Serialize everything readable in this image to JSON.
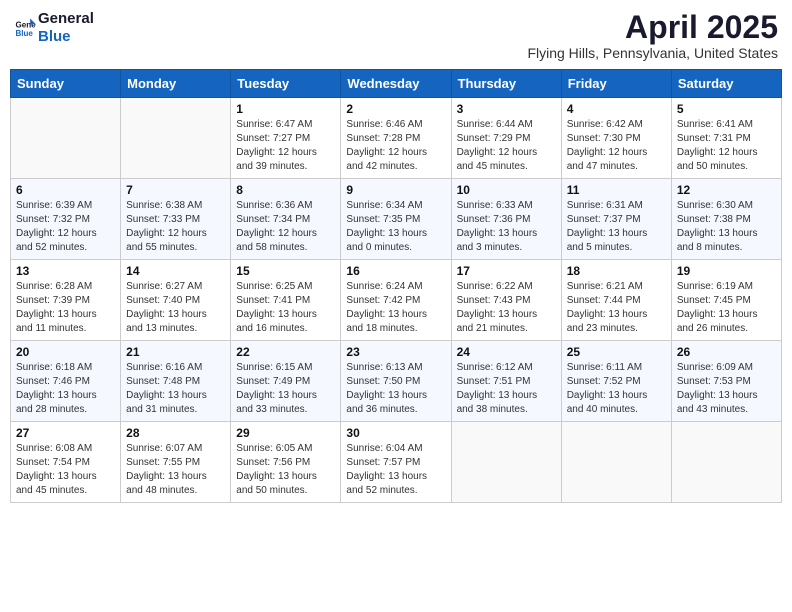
{
  "header": {
    "logo_line1": "General",
    "logo_line2": "Blue",
    "month": "April 2025",
    "location": "Flying Hills, Pennsylvania, United States"
  },
  "days_of_week": [
    "Sunday",
    "Monday",
    "Tuesday",
    "Wednesday",
    "Thursday",
    "Friday",
    "Saturday"
  ],
  "weeks": [
    [
      {
        "day": "",
        "info": ""
      },
      {
        "day": "",
        "info": ""
      },
      {
        "day": "1",
        "info": "Sunrise: 6:47 AM\nSunset: 7:27 PM\nDaylight: 12 hours and 39 minutes."
      },
      {
        "day": "2",
        "info": "Sunrise: 6:46 AM\nSunset: 7:28 PM\nDaylight: 12 hours and 42 minutes."
      },
      {
        "day": "3",
        "info": "Sunrise: 6:44 AM\nSunset: 7:29 PM\nDaylight: 12 hours and 45 minutes."
      },
      {
        "day": "4",
        "info": "Sunrise: 6:42 AM\nSunset: 7:30 PM\nDaylight: 12 hours and 47 minutes."
      },
      {
        "day": "5",
        "info": "Sunrise: 6:41 AM\nSunset: 7:31 PM\nDaylight: 12 hours and 50 minutes."
      }
    ],
    [
      {
        "day": "6",
        "info": "Sunrise: 6:39 AM\nSunset: 7:32 PM\nDaylight: 12 hours and 52 minutes."
      },
      {
        "day": "7",
        "info": "Sunrise: 6:38 AM\nSunset: 7:33 PM\nDaylight: 12 hours and 55 minutes."
      },
      {
        "day": "8",
        "info": "Sunrise: 6:36 AM\nSunset: 7:34 PM\nDaylight: 12 hours and 58 minutes."
      },
      {
        "day": "9",
        "info": "Sunrise: 6:34 AM\nSunset: 7:35 PM\nDaylight: 13 hours and 0 minutes."
      },
      {
        "day": "10",
        "info": "Sunrise: 6:33 AM\nSunset: 7:36 PM\nDaylight: 13 hours and 3 minutes."
      },
      {
        "day": "11",
        "info": "Sunrise: 6:31 AM\nSunset: 7:37 PM\nDaylight: 13 hours and 5 minutes."
      },
      {
        "day": "12",
        "info": "Sunrise: 6:30 AM\nSunset: 7:38 PM\nDaylight: 13 hours and 8 minutes."
      }
    ],
    [
      {
        "day": "13",
        "info": "Sunrise: 6:28 AM\nSunset: 7:39 PM\nDaylight: 13 hours and 11 minutes."
      },
      {
        "day": "14",
        "info": "Sunrise: 6:27 AM\nSunset: 7:40 PM\nDaylight: 13 hours and 13 minutes."
      },
      {
        "day": "15",
        "info": "Sunrise: 6:25 AM\nSunset: 7:41 PM\nDaylight: 13 hours and 16 minutes."
      },
      {
        "day": "16",
        "info": "Sunrise: 6:24 AM\nSunset: 7:42 PM\nDaylight: 13 hours and 18 minutes."
      },
      {
        "day": "17",
        "info": "Sunrise: 6:22 AM\nSunset: 7:43 PM\nDaylight: 13 hours and 21 minutes."
      },
      {
        "day": "18",
        "info": "Sunrise: 6:21 AM\nSunset: 7:44 PM\nDaylight: 13 hours and 23 minutes."
      },
      {
        "day": "19",
        "info": "Sunrise: 6:19 AM\nSunset: 7:45 PM\nDaylight: 13 hours and 26 minutes."
      }
    ],
    [
      {
        "day": "20",
        "info": "Sunrise: 6:18 AM\nSunset: 7:46 PM\nDaylight: 13 hours and 28 minutes."
      },
      {
        "day": "21",
        "info": "Sunrise: 6:16 AM\nSunset: 7:48 PM\nDaylight: 13 hours and 31 minutes."
      },
      {
        "day": "22",
        "info": "Sunrise: 6:15 AM\nSunset: 7:49 PM\nDaylight: 13 hours and 33 minutes."
      },
      {
        "day": "23",
        "info": "Sunrise: 6:13 AM\nSunset: 7:50 PM\nDaylight: 13 hours and 36 minutes."
      },
      {
        "day": "24",
        "info": "Sunrise: 6:12 AM\nSunset: 7:51 PM\nDaylight: 13 hours and 38 minutes."
      },
      {
        "day": "25",
        "info": "Sunrise: 6:11 AM\nSunset: 7:52 PM\nDaylight: 13 hours and 40 minutes."
      },
      {
        "day": "26",
        "info": "Sunrise: 6:09 AM\nSunset: 7:53 PM\nDaylight: 13 hours and 43 minutes."
      }
    ],
    [
      {
        "day": "27",
        "info": "Sunrise: 6:08 AM\nSunset: 7:54 PM\nDaylight: 13 hours and 45 minutes."
      },
      {
        "day": "28",
        "info": "Sunrise: 6:07 AM\nSunset: 7:55 PM\nDaylight: 13 hours and 48 minutes."
      },
      {
        "day": "29",
        "info": "Sunrise: 6:05 AM\nSunset: 7:56 PM\nDaylight: 13 hours and 50 minutes."
      },
      {
        "day": "30",
        "info": "Sunrise: 6:04 AM\nSunset: 7:57 PM\nDaylight: 13 hours and 52 minutes."
      },
      {
        "day": "",
        "info": ""
      },
      {
        "day": "",
        "info": ""
      },
      {
        "day": "",
        "info": ""
      }
    ]
  ]
}
